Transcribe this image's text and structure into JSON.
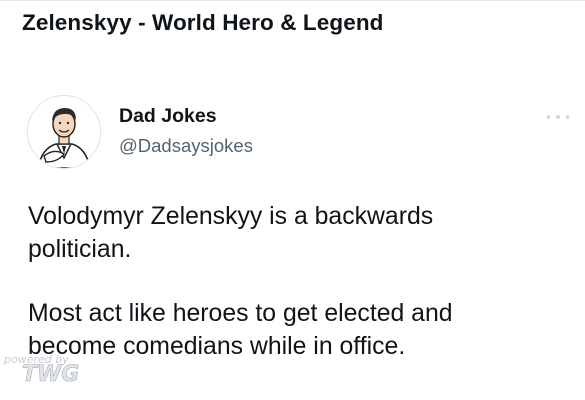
{
  "headline": "Zelenskyy - World Hero & Legend",
  "tweet": {
    "author": {
      "display_name": "Dad Jokes",
      "handle": "@Dadsaysjokes",
      "avatar_icon": "cartoon-man-avatar-icon"
    },
    "more_icon": "more-options-icon",
    "paragraphs": [
      [
        "Volodymyr Zelenskyy is a backwards",
        "politician."
      ],
      [
        "Most act like heroes to get elected and",
        "become comedians while in office."
      ]
    ]
  },
  "watermark": {
    "small_text": "powered by",
    "big_text": "TWG"
  }
}
